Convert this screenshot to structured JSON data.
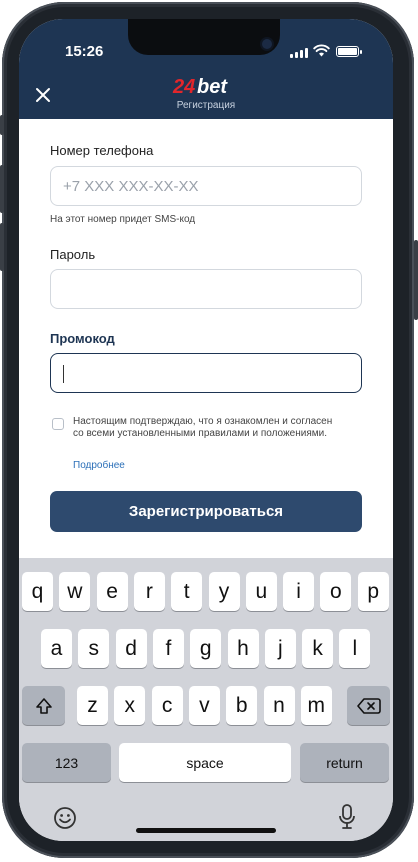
{
  "status_bar": {
    "time": "15:26"
  },
  "header": {
    "logo_num": "24",
    "logo_word": "bet",
    "subtitle": "Регистрация"
  },
  "form": {
    "phone": {
      "label": "Номер телефона",
      "placeholder": "+7 XXX XXX-XX-XX",
      "value": "",
      "hint": "На этот номер придет SMS-код"
    },
    "password": {
      "label": "Пароль",
      "value": ""
    },
    "promo": {
      "label": "Промокод",
      "value": ""
    },
    "consent": {
      "text": "Настоящим подтверждаю, что я ознакомлен и согласен со всеми установленными правилами и положениями.",
      "link": "Подробнее",
      "checked": false
    },
    "submit_label": "Зарегистрироваться"
  },
  "keyboard": {
    "row1": [
      "q",
      "w",
      "e",
      "r",
      "t",
      "y",
      "u",
      "i",
      "o",
      "p"
    ],
    "row2": [
      "a",
      "s",
      "d",
      "f",
      "g",
      "h",
      "j",
      "k",
      "l"
    ],
    "row3": [
      "z",
      "x",
      "c",
      "v",
      "b",
      "n",
      "m"
    ],
    "numbers_key": "123",
    "space_key": "space",
    "return_key": "return",
    "icons": {
      "shift": "shift-icon",
      "backspace": "backspace-icon",
      "emoji": "emoji-icon",
      "mic": "microphone-icon"
    }
  },
  "colors": {
    "header_bg": "#1e3553",
    "logo_red": "#e2262b",
    "button_bg": "#2e4a6e",
    "link": "#2b6fb8",
    "keyboard_bg": "#d1d3d9"
  }
}
